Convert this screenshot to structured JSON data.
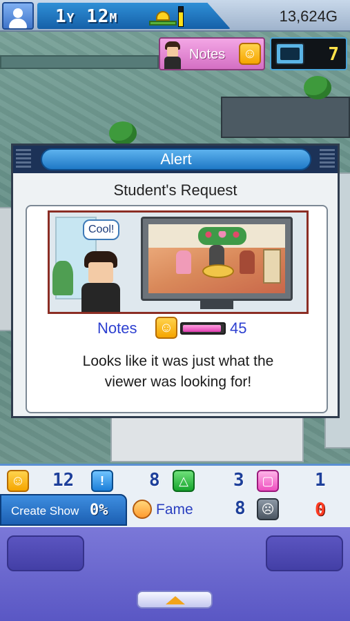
{
  "hud": {
    "date_years": "1",
    "date_years_unit": "Y",
    "date_months": "12",
    "date_months_unit": "M",
    "gold": "13,624G",
    "weather_level": 0.7
  },
  "notes_chip": {
    "label": "Notes"
  },
  "tv_counter": {
    "count": "7"
  },
  "alert": {
    "header": "Alert",
    "title": "Student's Request",
    "bubble": "Cool!",
    "stat_label": "Notes",
    "stat_value": "45",
    "stat_fill_fraction": 0.95,
    "message_line1": "Looks like it was just what the",
    "message_line2": "viewer was looking for!"
  },
  "stats": {
    "s1": "12",
    "s2": "8",
    "s3": "3",
    "s4": "1",
    "fame_value": "8",
    "red_value": "0"
  },
  "create_show": {
    "label": "Create Show",
    "percent": "0%"
  },
  "fame": {
    "label": "Fame"
  },
  "colors": {
    "accent_blue": "#1f79c6",
    "notes_pink": "#e040b2",
    "stat_text": "#2c3fd0"
  }
}
